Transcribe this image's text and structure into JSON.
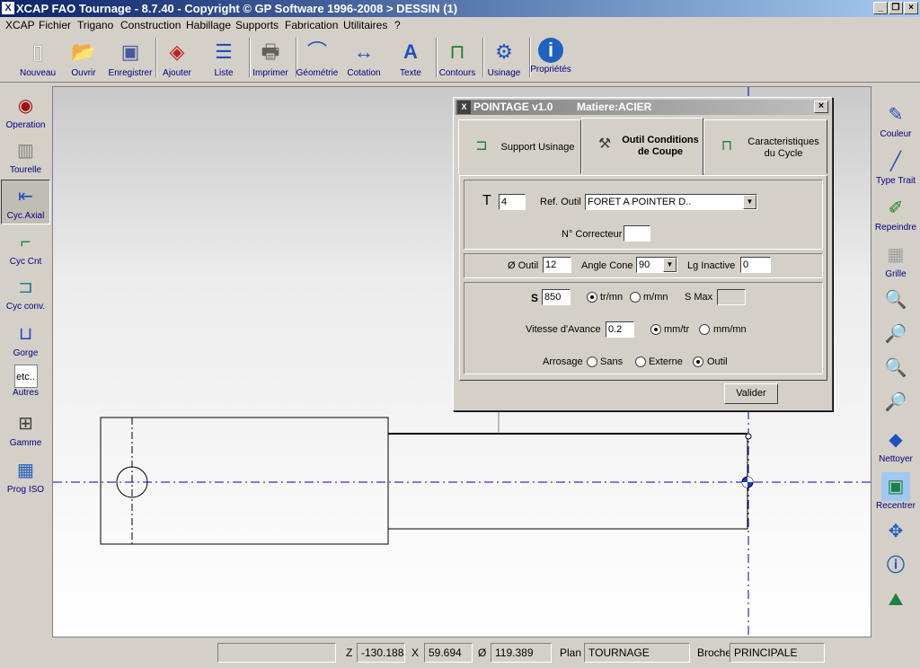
{
  "window": {
    "title": "XCAP FAO Tournage - 8.7.40 - Copyright © GP Software 1996-2008 > DESSIN (1)"
  },
  "menu": [
    "XCAP",
    "Fichier",
    "Trigano",
    "Construction",
    "Habillage",
    "Supports",
    "Fabrication",
    "Utilitaires",
    "?"
  ],
  "toolbar": [
    "Nouveau",
    "Ouvrir",
    "Enregistrer",
    "Ajouter",
    "Liste",
    "Imprimer",
    "Géométrie",
    "Cotation",
    "Texte",
    "Contours",
    "Usinage",
    "Propriétés"
  ],
  "left_palette": [
    "Operation",
    "Tourelle",
    "Cyc.Axial",
    "Cyc Cnt",
    "Cyc conv.",
    "Gorge",
    "Autres",
    "Gamme",
    "Prog ISO"
  ],
  "left_palette_extra": {
    "autres_icon_text": "etc.."
  },
  "right_palette": [
    "Couleur",
    "Type Trait",
    "Repeindre",
    "Grille",
    "Nettoyer",
    "Recentrer"
  ],
  "dialog": {
    "title": "POINTAGE v1.0",
    "matiere": "Matiere:ACIER",
    "tabs": [
      {
        "label": "Support Usinage",
        "selected": false
      },
      {
        "label": "Outil Conditions de Coupe",
        "selected": true
      },
      {
        "label": "Caracteristiques du Cycle",
        "selected": false
      }
    ],
    "tool": {
      "t_label": "T",
      "t_value": "4",
      "ref_label": "Ref. Outil",
      "ref_value": "FORET A POINTER D..",
      "correcteur_label": "N° Correcteur",
      "correcteur_value": ""
    },
    "geometry": {
      "diam_label": "Ø Outil",
      "diam_value": "12",
      "angle_label": "Angle Cone",
      "angle_value": "90",
      "lg_label": "Lg Inactive",
      "lg_value": "0"
    },
    "cutting": {
      "s_label": "S",
      "s_value": "850",
      "trmn": "tr/mn",
      "mmn": "m/mn",
      "smax_label": "S Max",
      "smax_value": "",
      "avance_label": "Vitesse d'Avance",
      "avance_value": "0.2",
      "mmtr": "mm/tr",
      "mmmn": "mm/mn",
      "arrosage_label": "Arrosage",
      "sans": "Sans",
      "externe": "Externe",
      "outil": "Outil"
    },
    "validate_label": "Valider"
  },
  "statusbar": {
    "z_label": "Z",
    "z_value": "-130.188",
    "x_label": "X",
    "x_value": "59.694",
    "d_label": "Ø",
    "d_value": "119.389",
    "plan_label": "Plan",
    "plan_value": "TOURNAGE",
    "broche_label": "Broche",
    "broche_value": "PRINCIPALE"
  }
}
